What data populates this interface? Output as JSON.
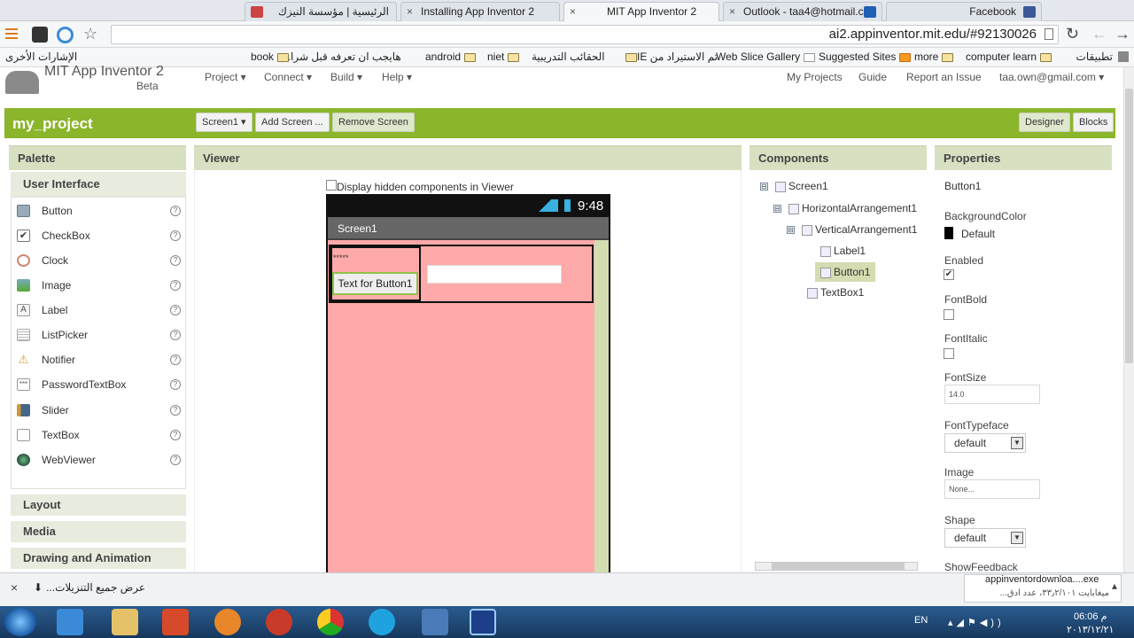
{
  "browser": {
    "tabs": [
      {
        "label": "الرئيسية | مؤسسة النيزك",
        "close": "×"
      },
      {
        "label": "Installing App Inventor 2",
        "close": "×"
      },
      {
        "label": "MIT App Inventor 2",
        "close": "×"
      },
      {
        "label": "Outlook - taa4@hotmail.c",
        "close": "×"
      },
      {
        "label": "Facebook",
        "close": ""
      }
    ],
    "url": "ai2.appinventor.mit.edu/#92130026",
    "bookmarks": [
      {
        "label": "تطبيقات"
      },
      {
        "label": "computer learn"
      },
      {
        "label": "more"
      },
      {
        "label": "Suggested Sites"
      },
      {
        "label": "Web Slice Gallery"
      },
      {
        "label": "تم الاستيراد من IE"
      },
      {
        "label": "الحقائب التدريبية"
      },
      {
        "label": "niet"
      },
      {
        "label": "android"
      },
      {
        "label": "هايجب ان تعرفه قبل شرا..."
      },
      {
        "label": "book"
      },
      {
        "label": "الإشارات الأخرى"
      }
    ]
  },
  "app": {
    "brand": "MIT App Inventor 2",
    "beta": "Beta",
    "menus": [
      "Project ▾",
      "Connect ▾",
      "Build ▾",
      "Help ▾"
    ],
    "right_links": [
      "My Projects",
      "Guide",
      "Report an Issue",
      "taa.own@gmail.com ▾"
    ],
    "project_name": "my_project",
    "screen_select": "Screen1 ▾",
    "add_screen": "Add Screen ...",
    "remove_screen": "Remove Screen",
    "designer": "Designer",
    "blocks": "Blocks"
  },
  "palette": {
    "title": "Palette",
    "category": "User Interface",
    "items": [
      {
        "label": "Button",
        "icon": "button-icon"
      },
      {
        "label": "CheckBox",
        "icon": "checkbox-icon"
      },
      {
        "label": "Clock",
        "icon": "clock-icon"
      },
      {
        "label": "Image",
        "icon": "image-icon"
      },
      {
        "label": "Label",
        "icon": "label-icon"
      },
      {
        "label": "ListPicker",
        "icon": "listpicker-icon"
      },
      {
        "label": "Notifier",
        "icon": "notifier-icon"
      },
      {
        "label": "PasswordTextBox",
        "icon": "password-icon"
      },
      {
        "label": "Slider",
        "icon": "slider-icon"
      },
      {
        "label": "TextBox",
        "icon": "textbox-icon"
      },
      {
        "label": "WebViewer",
        "icon": "webviewer-icon"
      }
    ],
    "help": "?",
    "sections": [
      "Layout",
      "Media",
      "Drawing and Animation"
    ]
  },
  "viewer": {
    "title": "Viewer",
    "hidden_label": "Display hidden components in Viewer",
    "time": "9:48",
    "screen_title": "Screen1",
    "label_text": "*****",
    "button_text": "Text for Button1"
  },
  "components": {
    "title": "Components",
    "tree": [
      "Screen1",
      "HorizontalArrangement1",
      "VerticalArrangement1",
      "Label1",
      "Button1",
      "TextBox1"
    ],
    "collapse": "⊟"
  },
  "properties": {
    "title": "Properties",
    "component": "Button1",
    "bg_label": "BackgroundColor",
    "bg_value": "Default",
    "enabled_label": "Enabled",
    "fontbold_label": "FontBold",
    "fontitalic_label": "FontItalic",
    "fontsize_label": "FontSize",
    "fontsize_value": "14.0",
    "typeface_label": "FontTypeface",
    "typeface_value": "default",
    "image_label": "Image",
    "image_value": "None...",
    "shape_label": "Shape",
    "shape_value": "default",
    "feedback_label": "ShowFeedback"
  },
  "downloads": {
    "show_all": "عرض جميع التنزيلات...",
    "file_name": "appinventordownloa....exe",
    "file_status": "ميغابايت ٣٣٫٢/١٠١، عدد ادق...",
    "close": "×"
  },
  "taskbar": {
    "lang": "EN",
    "time": "06:06 م",
    "date": "٢٠١٣/١٢/٢١"
  },
  "colors": {
    "accent_green": "#8bb52b",
    "phone_bg": "#ffaaaa",
    "panel_header": "#d8e0c2"
  }
}
